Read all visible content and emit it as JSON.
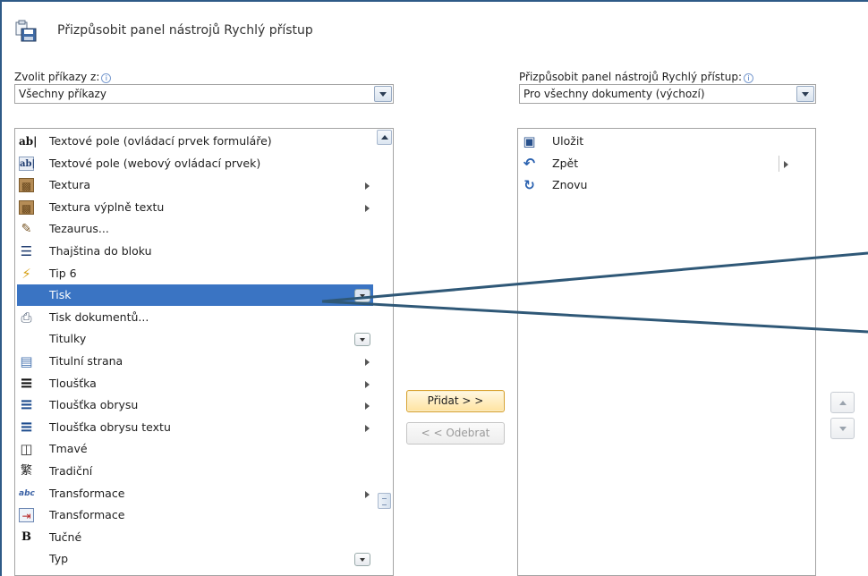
{
  "header": {
    "title": "Přizpůsobit panel nástrojů Rychlý přístup"
  },
  "left": {
    "label": "Zvolit příkazy z:",
    "combo_value": "Všechny příkazy",
    "items": [
      {
        "icon": "text-field-control-icon",
        "glyph": "ab|",
        "label": "Textové pole (ovládací prvek formuláře)",
        "submenu": false
      },
      {
        "icon": "text-field-web-icon",
        "glyph": "ab|",
        "label": "Textové pole (webový ovládací prvek)",
        "submenu": false
      },
      {
        "icon": "texture-icon",
        "glyph": "▩",
        "label": "Textura",
        "submenu": true
      },
      {
        "icon": "texture-fill-icon",
        "glyph": "▩",
        "label": "Textura výplně textu",
        "submenu": true
      },
      {
        "icon": "thesaurus-icon",
        "glyph": "✎",
        "label": "Tezaurus...",
        "submenu": false
      },
      {
        "icon": "thai-distribute-icon",
        "glyph": "☰",
        "label": "Thajština do bloku",
        "submenu": false
      },
      {
        "icon": "lightning-icon",
        "glyph": "⚡",
        "label": "Tip 6",
        "submenu": false
      },
      {
        "icon": "",
        "glyph": "",
        "label": "Tisk",
        "submenu": false,
        "dropdown": true,
        "selected": true
      },
      {
        "icon": "print-document-icon",
        "glyph": "⎙",
        "label": "Tisk dokumentů...",
        "submenu": false
      },
      {
        "icon": "",
        "glyph": "",
        "label": "Titulky",
        "submenu": false,
        "dropdown": true
      },
      {
        "icon": "title-page-icon",
        "glyph": "▤",
        "label": "Titulní strana",
        "submenu": true
      },
      {
        "icon": "line-weight-icon",
        "glyph": "≡",
        "label": "Tloušťka",
        "submenu": true
      },
      {
        "icon": "outline-weight-icon",
        "glyph": "≡",
        "label": "Tloušťka obrysu",
        "submenu": true
      },
      {
        "icon": "text-outline-weight-icon",
        "glyph": "≡",
        "label": "Tloušťka obrysu textu",
        "submenu": true
      },
      {
        "icon": "dark-3d-icon",
        "glyph": "◫",
        "label": "Tmavé",
        "submenu": false
      },
      {
        "icon": "traditional-chinese-icon",
        "glyph": "繁",
        "label": "Tradiční",
        "submenu": false
      },
      {
        "icon": "transform-icon",
        "glyph": "abc",
        "label": "Transformace",
        "submenu": true
      },
      {
        "icon": "transform-box-icon",
        "glyph": "⇥",
        "label": "Transformace",
        "submenu": false
      },
      {
        "icon": "bold-icon",
        "glyph": "B",
        "label": "Tučné",
        "submenu": false
      },
      {
        "icon": "",
        "glyph": "",
        "label": "Typ",
        "submenu": false,
        "dropdown": true
      }
    ]
  },
  "right": {
    "label": "Přizpůsobit panel nástrojů Rychlý přístup:",
    "combo_value": "Pro všechny dokumenty (výchozí)",
    "items": [
      {
        "icon": "save-icon",
        "glyph": "▣",
        "label": "Uložit",
        "submenu": false
      },
      {
        "icon": "undo-icon",
        "glyph": "↶",
        "label": "Zpět",
        "submenu": true
      },
      {
        "icon": "redo-icon",
        "glyph": "↻",
        "label": "Znovu",
        "submenu": false
      }
    ]
  },
  "buttons": {
    "add": "Přidat > >",
    "remove": "< < Odebrat"
  },
  "colors": {
    "selection": "#3a74c3",
    "frame": "#2e5a87",
    "callout": "#2f5877"
  }
}
